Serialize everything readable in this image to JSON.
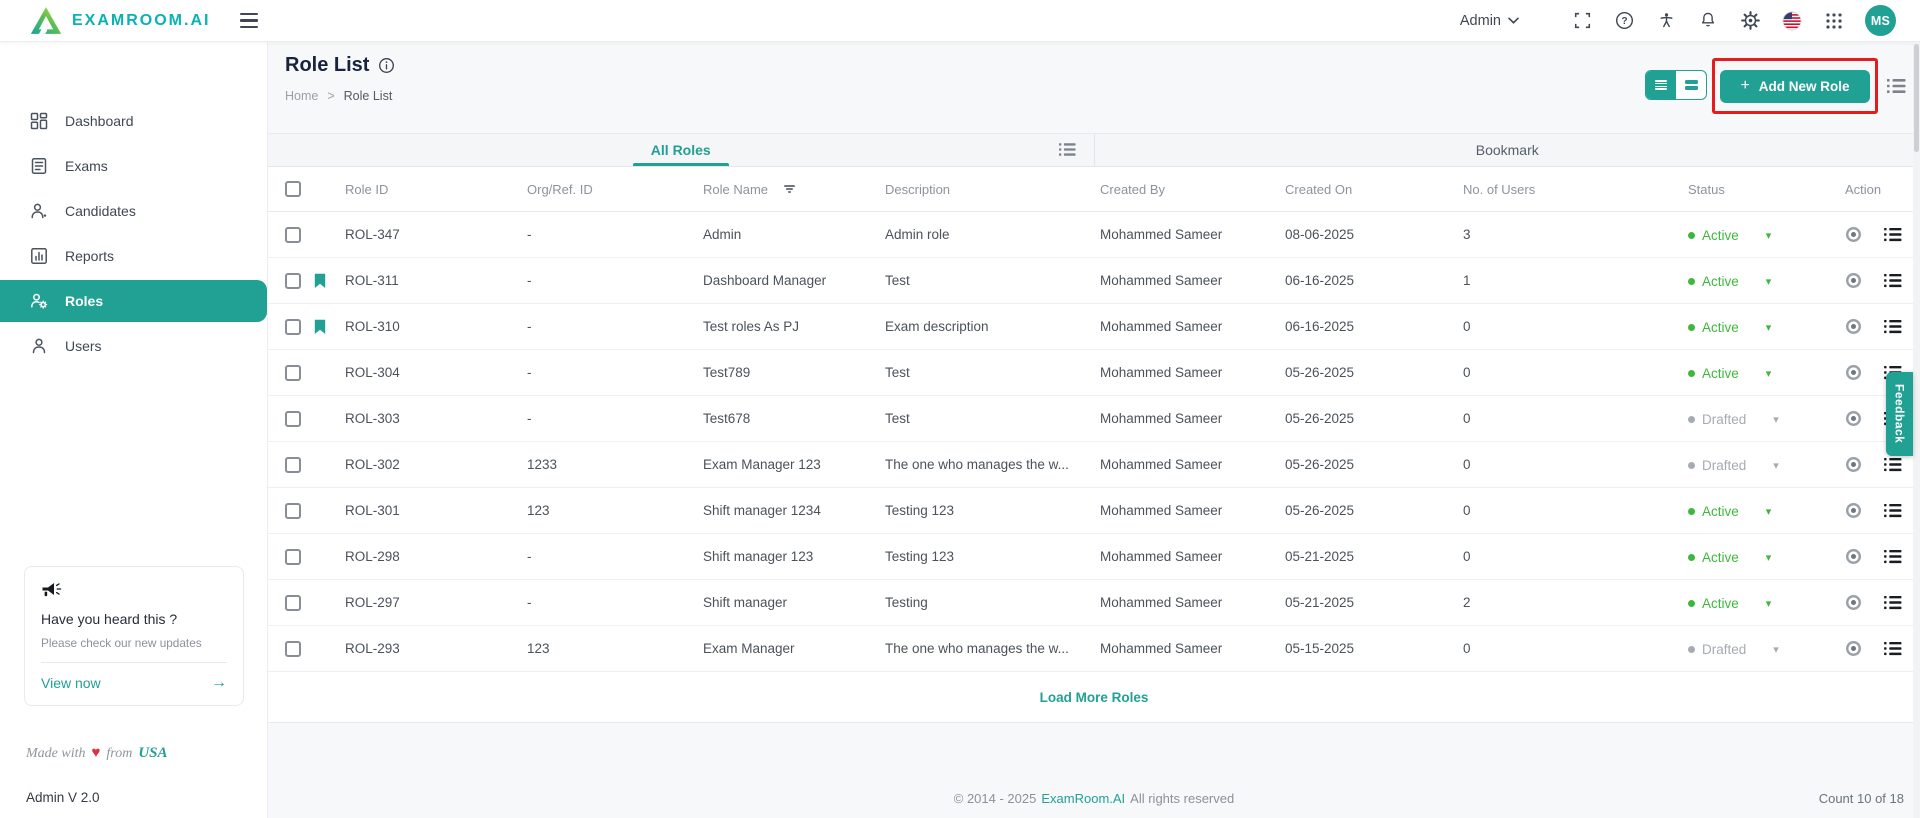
{
  "colors": {
    "primary": "#21A094",
    "logo_teal": "#0AB2B4",
    "active_green": "#3CB93C",
    "drafted_gray": "#A6ABB3",
    "annotation_red": "#E51C1C"
  },
  "header": {
    "brand": "EXAMROOM.AI",
    "admin_label": "Admin",
    "avatar_initials": "MS"
  },
  "sidebar": {
    "items": [
      {
        "label": "Dashboard",
        "active": false
      },
      {
        "label": "Exams",
        "active": false
      },
      {
        "label": "Candidates",
        "active": false
      },
      {
        "label": "Reports",
        "active": false
      },
      {
        "label": "Roles",
        "active": true
      },
      {
        "label": "Users",
        "active": false
      }
    ],
    "promo": {
      "title": "Have you heard this ?",
      "subtitle": "Please check our new updates",
      "link_label": "View now",
      "arrow": "→"
    },
    "made_with": {
      "prefix": "Made with",
      "heart": "♥",
      "middle": "from",
      "country": "USA"
    },
    "version": "Admin V 2.0"
  },
  "page": {
    "title": "Role List",
    "breadcrumb": {
      "home": "Home",
      "separator": ">",
      "current": "Role List"
    },
    "add_new_plus": "+",
    "add_new_label": "Add New Role",
    "tabs": {
      "all_roles": "All Roles",
      "bookmark": "Bookmark"
    },
    "load_more_label": "Load More Roles",
    "count_label": "Count 10 of 18"
  },
  "table": {
    "columns": {
      "role_id": "Role ID",
      "org_ref": "Org/Ref. ID",
      "role_name": "Role Name",
      "description": "Description",
      "created_by": "Created By",
      "created_on": "Created On",
      "users": "No. of Users",
      "status": "Status",
      "action": "Action"
    },
    "rows": [
      {
        "bookmarked": false,
        "role_id": "ROL-347",
        "org_ref": "-",
        "role_name": "Admin",
        "description": "Admin role",
        "created_by": "Mohammed Sameer",
        "created_on": "08-06-2025",
        "users": "3",
        "status": "Active",
        "status_type": "active"
      },
      {
        "bookmarked": true,
        "role_id": "ROL-311",
        "org_ref": "-",
        "role_name": "Dashboard Manager",
        "description": "Test",
        "created_by": "Mohammed Sameer",
        "created_on": "06-16-2025",
        "users": "1",
        "status": "Active",
        "status_type": "active"
      },
      {
        "bookmarked": true,
        "role_id": "ROL-310",
        "org_ref": "-",
        "role_name": "Test roles As PJ",
        "description": "Exam description",
        "created_by": "Mohammed Sameer",
        "created_on": "06-16-2025",
        "users": "0",
        "status": "Active",
        "status_type": "active"
      },
      {
        "bookmarked": false,
        "role_id": "ROL-304",
        "org_ref": "-",
        "role_name": "Test789",
        "description": "Test",
        "created_by": "Mohammed Sameer",
        "created_on": "05-26-2025",
        "users": "0",
        "status": "Active",
        "status_type": "active"
      },
      {
        "bookmarked": false,
        "role_id": "ROL-303",
        "org_ref": "-",
        "role_name": "Test678",
        "description": "Test",
        "created_by": "Mohammed Sameer",
        "created_on": "05-26-2025",
        "users": "0",
        "status": "Drafted",
        "status_type": "drafted"
      },
      {
        "bookmarked": false,
        "role_id": "ROL-302",
        "org_ref": "1233",
        "role_name": "Exam Manager 123",
        "description": "The one who manages the w...",
        "created_by": "Mohammed Sameer",
        "created_on": "05-26-2025",
        "users": "0",
        "status": "Drafted",
        "status_type": "drafted"
      },
      {
        "bookmarked": false,
        "role_id": "ROL-301",
        "org_ref": "123",
        "role_name": "Shift manager 1234",
        "description": "Testing 123",
        "created_by": "Mohammed Sameer",
        "created_on": "05-26-2025",
        "users": "0",
        "status": "Active",
        "status_type": "active"
      },
      {
        "bookmarked": false,
        "role_id": "ROL-298",
        "org_ref": "-",
        "role_name": "Shift manager 123",
        "description": "Testing 123",
        "created_by": "Mohammed Sameer",
        "created_on": "05-21-2025",
        "users": "0",
        "status": "Active",
        "status_type": "active"
      },
      {
        "bookmarked": false,
        "role_id": "ROL-297",
        "org_ref": "-",
        "role_name": "Shift manager",
        "description": "Testing",
        "created_by": "Mohammed Sameer",
        "created_on": "05-21-2025",
        "users": "2",
        "status": "Active",
        "status_type": "active"
      },
      {
        "bookmarked": false,
        "role_id": "ROL-293",
        "org_ref": "123",
        "role_name": "Exam Manager",
        "description": "The one who manages the w...",
        "created_by": "Mohammed Sameer",
        "created_on": "05-15-2025",
        "users": "0",
        "status": "Drafted",
        "status_type": "drafted"
      }
    ]
  },
  "footer": {
    "copyright_prefix": "© 2014 - 2025",
    "brand": "ExamRoom.AI",
    "copyright_suffix": "All rights reserved"
  },
  "feedback_label": "Feedback"
}
